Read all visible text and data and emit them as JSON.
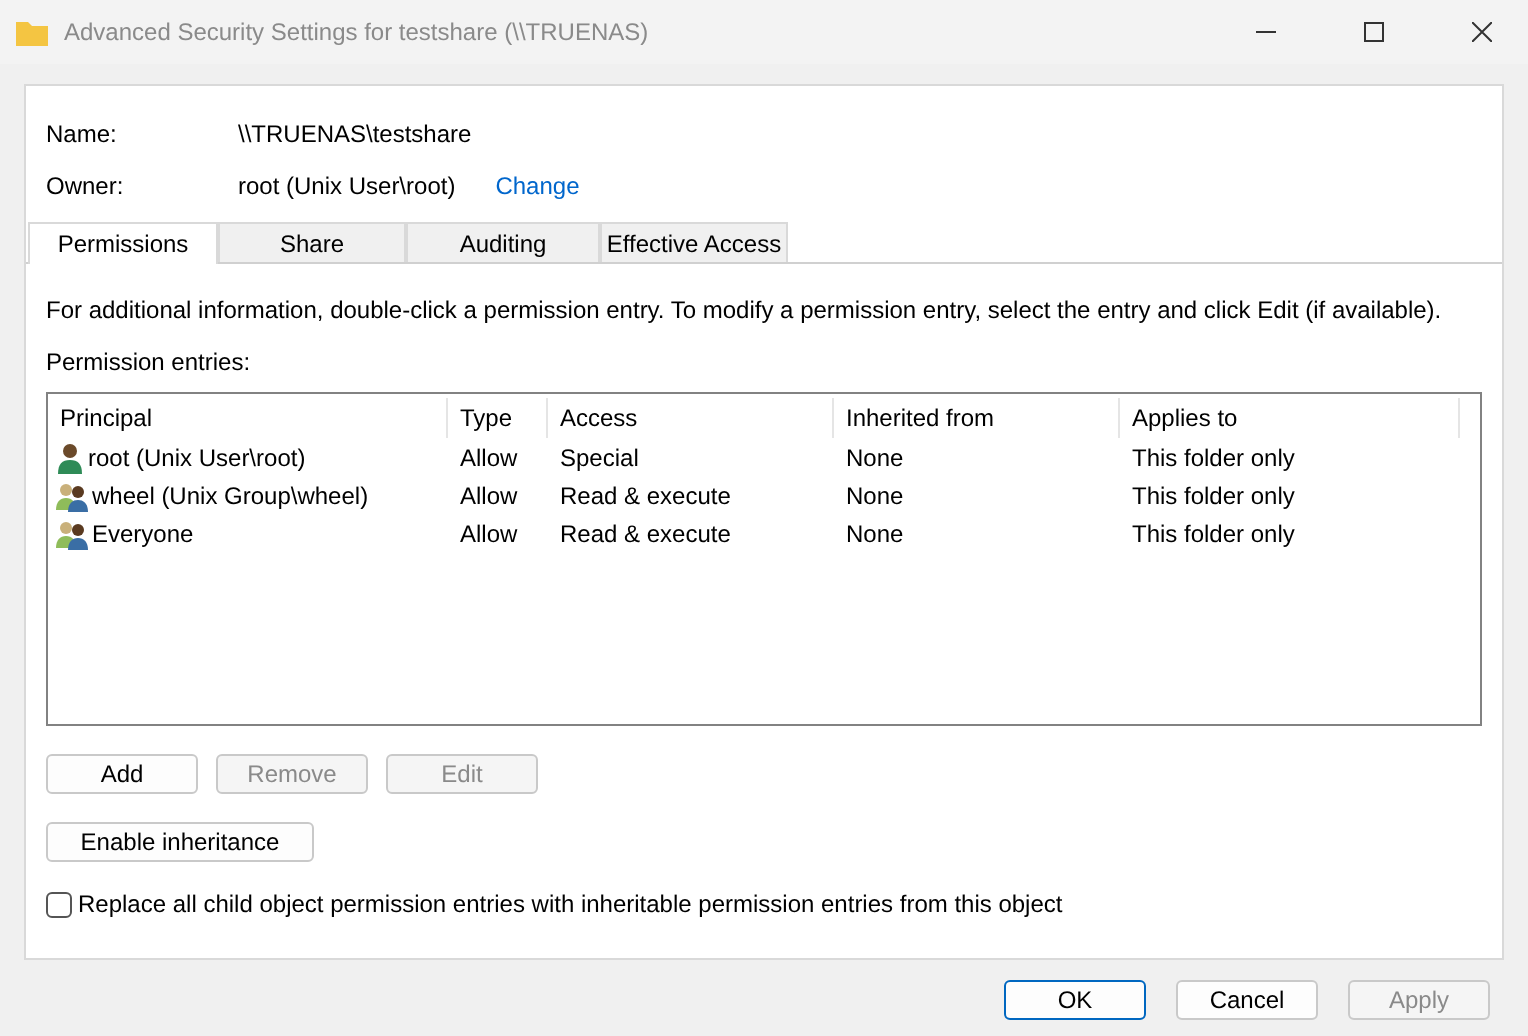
{
  "window": {
    "title": "Advanced Security Settings for testshare (\\\\TRUENAS)"
  },
  "name": {
    "label": "Name:",
    "value": "\\\\TRUENAS\\testshare"
  },
  "owner": {
    "label": "Owner:",
    "value": "root (Unix User\\root)",
    "link": "Change"
  },
  "tabs": [
    {
      "label": "Permissions",
      "selected": true
    },
    {
      "label": "Share",
      "selected": false
    },
    {
      "label": "Auditing",
      "selected": false
    },
    {
      "label": "Effective Access",
      "selected": false
    }
  ],
  "info": "For additional information, double-click a permission entry. To modify a permission entry, select the entry and click Edit (if available).",
  "entries_label": "Permission entries:",
  "table": {
    "columns": [
      "Principal",
      "Type",
      "Access",
      "Inherited from",
      "Applies to"
    ],
    "rows": [
      {
        "kind": "user",
        "cells": [
          "root (Unix User\\root)",
          "Allow",
          "Special",
          "None",
          "This folder only"
        ]
      },
      {
        "kind": "group",
        "cells": [
          "wheel (Unix Group\\wheel)",
          "Allow",
          "Read & execute",
          "None",
          "This folder only"
        ]
      },
      {
        "kind": "group",
        "cells": [
          "Everyone",
          "Allow",
          "Read & execute",
          "None",
          "This folder only"
        ]
      }
    ]
  },
  "entry_buttons": [
    {
      "label": "Add",
      "disabled": false
    },
    {
      "label": "Remove",
      "disabled": true
    },
    {
      "label": "Edit",
      "disabled": true
    }
  ],
  "inheritance_button": "Enable inheritance",
  "replace_checkbox": {
    "label": "Replace all child object permission entries with inheritable permission entries from this object",
    "checked": false
  },
  "dialog_buttons": [
    {
      "label": "OK",
      "disabled": false,
      "default": true
    },
    {
      "label": "Cancel",
      "disabled": false,
      "default": false
    },
    {
      "label": "Apply",
      "disabled": true,
      "default": false
    }
  ]
}
